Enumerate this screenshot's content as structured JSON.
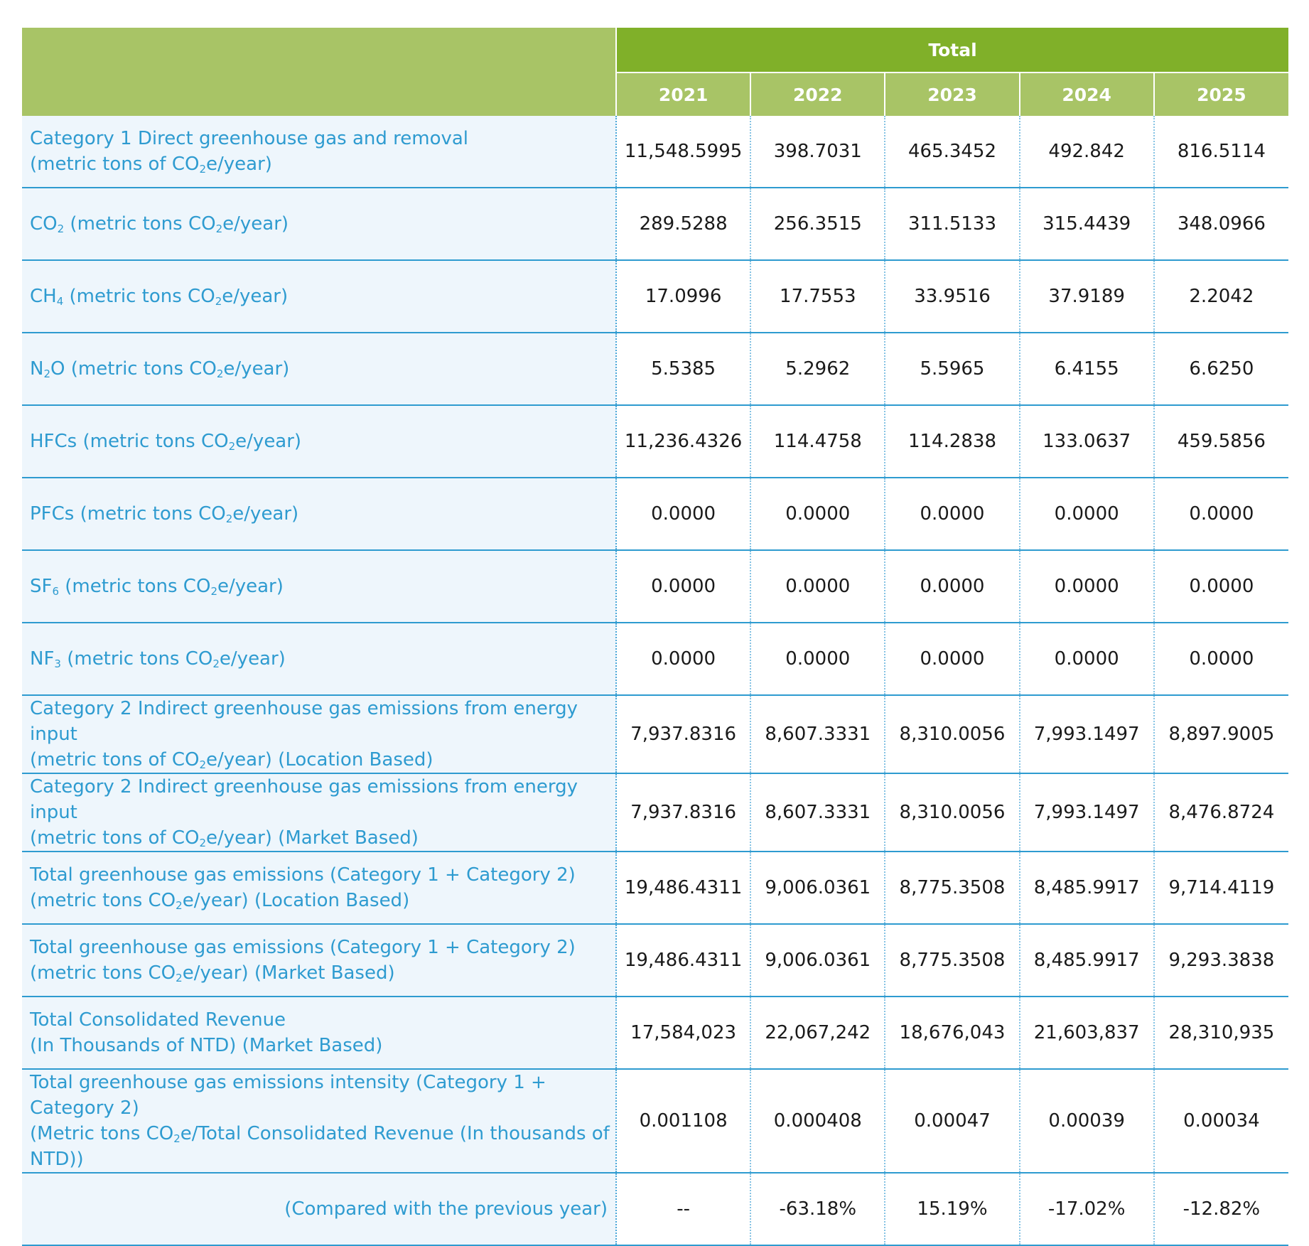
{
  "header": {
    "group_label": "Total",
    "years": [
      "2021",
      "2022",
      "2023",
      "2024",
      "2025"
    ]
  },
  "rows": [
    {
      "line1": [
        {
          "t": "Category 1 Direct greenhouse gas and removal"
        }
      ],
      "line2": [
        {
          "t": "(metric tons of CO"
        },
        {
          "t": "2",
          "sub": true
        },
        {
          "t": "e/year)"
        }
      ],
      "values": [
        "11,548.5995",
        "398.7031",
        "465.3452",
        "492.842",
        "816.5114"
      ]
    },
    {
      "line1": [
        {
          "t": "CO"
        },
        {
          "t": "2",
          "sub": true
        },
        {
          "t": " (metric tons CO"
        },
        {
          "t": "2",
          "sub": true
        },
        {
          "t": "e/year)"
        }
      ],
      "values": [
        "289.5288",
        "256.3515",
        "311.5133",
        "315.4439",
        "348.0966"
      ]
    },
    {
      "line1": [
        {
          "t": "CH"
        },
        {
          "t": "4",
          "sub": true
        },
        {
          "t": " (metric tons CO"
        },
        {
          "t": "2",
          "sub": true
        },
        {
          "t": "e/year)"
        }
      ],
      "values": [
        "17.0996",
        "17.7553",
        "33.9516",
        "37.9189",
        "2.2042"
      ]
    },
    {
      "line1": [
        {
          "t": "N"
        },
        {
          "t": "2",
          "sub": true
        },
        {
          "t": "O (metric tons CO"
        },
        {
          "t": "2",
          "sub": true
        },
        {
          "t": "e/year)"
        }
      ],
      "values": [
        "5.5385",
        "5.2962",
        "5.5965",
        "6.4155",
        "6.6250"
      ]
    },
    {
      "line1": [
        {
          "t": "HFCs (metric tons CO"
        },
        {
          "t": "2",
          "sub": true
        },
        {
          "t": "e/year)"
        }
      ],
      "values": [
        "11,236.4326",
        "114.4758",
        "114.2838",
        "133.0637",
        "459.5856"
      ]
    },
    {
      "line1": [
        {
          "t": "PFCs (metric tons CO"
        },
        {
          "t": "2",
          "sub": true
        },
        {
          "t": "e/year)"
        }
      ],
      "values": [
        "0.0000",
        "0.0000",
        "0.0000",
        "0.0000",
        "0.0000"
      ]
    },
    {
      "line1": [
        {
          "t": "SF"
        },
        {
          "t": "6",
          "sub": true
        },
        {
          "t": " (metric tons CO"
        },
        {
          "t": "2",
          "sub": true
        },
        {
          "t": "e/year)"
        }
      ],
      "values": [
        "0.0000",
        "0.0000",
        "0.0000",
        "0.0000",
        "0.0000"
      ]
    },
    {
      "line1": [
        {
          "t": "NF"
        },
        {
          "t": "3",
          "sub": true
        },
        {
          "t": " (metric tons CO"
        },
        {
          "t": "2",
          "sub": true
        },
        {
          "t": "e/year)"
        }
      ],
      "values": [
        "0.0000",
        "0.0000",
        "0.0000",
        "0.0000",
        "0.0000"
      ]
    },
    {
      "line1": [
        {
          "t": "Category 2 Indirect greenhouse gas emissions from energy input"
        }
      ],
      "line2": [
        {
          "t": "(metric tons of CO"
        },
        {
          "t": "2",
          "sub": true
        },
        {
          "t": "e/year) (Location Based)"
        }
      ],
      "values": [
        "7,937.8316",
        "8,607.3331",
        "8,310.0056",
        "7,993.1497",
        "8,897.9005"
      ]
    },
    {
      "line1": [
        {
          "t": "Category 2 Indirect greenhouse gas emissions from energy input"
        }
      ],
      "line2": [
        {
          "t": "(metric tons of CO"
        },
        {
          "t": "2",
          "sub": true
        },
        {
          "t": "e/year) (Market Based)"
        }
      ],
      "values": [
        "7,937.8316",
        "8,607.3331",
        "8,310.0056",
        "7,993.1497",
        "8,476.8724"
      ]
    },
    {
      "line1": [
        {
          "t": "Total greenhouse gas emissions (Category 1 + Category 2)"
        }
      ],
      "line2": [
        {
          "t": "(metric tons CO"
        },
        {
          "t": "2",
          "sub": true
        },
        {
          "t": "e/year) (Location Based)"
        }
      ],
      "values": [
        "19,486.4311",
        "9,006.0361",
        "8,775.3508",
        "8,485.9917",
        "9,714.4119"
      ]
    },
    {
      "line1": [
        {
          "t": "Total greenhouse gas emissions (Category 1 + Category 2)"
        }
      ],
      "line2": [
        {
          "t": "(metric tons CO"
        },
        {
          "t": "2",
          "sub": true
        },
        {
          "t": "e/year) (Market Based)"
        }
      ],
      "values": [
        "19,486.4311",
        "9,006.0361",
        "8,775.3508",
        "8,485.9917",
        "9,293.3838"
      ]
    },
    {
      "line1": [
        {
          "t": "Total Consolidated Revenue"
        }
      ],
      "line2": [
        {
          "t": "(In Thousands of NTD) (Market Based)"
        }
      ],
      "values": [
        "17,584,023",
        "22,067,242",
        "18,676,043",
        "21,603,837",
        "28,310,935"
      ]
    },
    {
      "line1": [
        {
          "t": "Total greenhouse gas emissions intensity (Category 1 + Category 2)"
        }
      ],
      "line2": [
        {
          "t": "(Metric tons CO"
        },
        {
          "t": "2",
          "sub": true
        },
        {
          "t": "e/Total Consolidated Revenue (In thousands of NTD))"
        }
      ],
      "values": [
        "0.001108",
        "0.000408",
        "0.00047",
        "0.00039",
        "0.00034"
      ]
    },
    {
      "align": "right",
      "line1": [
        {
          "t": "(Compared with the previous year)"
        }
      ],
      "values": [
        "--",
        "-63.18%",
        "15.19%",
        "-17.02%",
        "-12.82%"
      ]
    }
  ]
}
